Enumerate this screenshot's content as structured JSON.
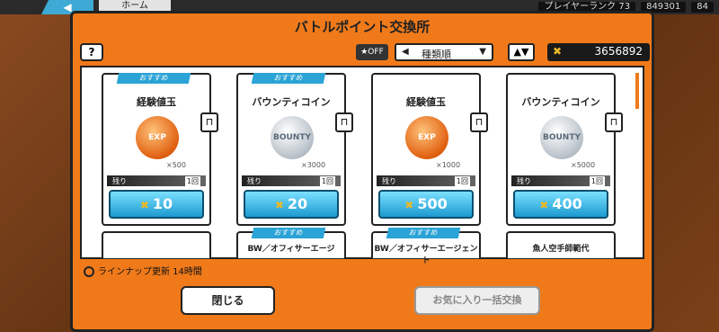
{
  "topbar": {
    "back_label": "◀",
    "home_label": "ホーム",
    "player_rank_label": "プレイヤーランク 73",
    "currency1": "849301",
    "currency2": "84"
  },
  "dialog": {
    "title": "バトルポイント交換所",
    "help_label": "?",
    "fav_toggle_label": "★OFF",
    "sort_label": "種類順",
    "order_label": "▲▼",
    "points_value": "3656892",
    "lineup_text": "ラインナップ更新 14時間",
    "close_label": "閉じる",
    "fav_exchange_label": "お気に入り一括交換"
  },
  "cards": [
    {
      "recommend": "おすすめ",
      "name": "経験値玉",
      "icon": "exp-orb",
      "qty": "×500",
      "remain_label": "残り",
      "remain_value": "1回",
      "price": "10"
    },
    {
      "recommend": "おすすめ",
      "name": "バウンティコイン",
      "icon": "bounty-coin",
      "qty": "×3000",
      "remain_label": "残り",
      "remain_value": "1回",
      "price": "20"
    },
    {
      "recommend": "",
      "name": "経験値玉",
      "icon": "exp-orb",
      "qty": "×1000",
      "remain_label": "残り",
      "remain_value": "1回",
      "price": "500"
    },
    {
      "recommend": "",
      "name": "バウンティコイン",
      "icon": "bounty-coin",
      "qty": "×5000",
      "remain_label": "残り",
      "remain_value": "1回",
      "price": "400"
    }
  ],
  "next_cards": [
    {
      "recommend": "",
      "name": ""
    },
    {
      "recommend": "おすすめ",
      "name": "BW／オフィサーエージ"
    },
    {
      "recommend": "おすすめ",
      "name": "BW／オフィサーエージェント"
    },
    {
      "recommend": "",
      "name": "魚人空手師範代"
    }
  ],
  "colors": {
    "orange": "#f07a1a",
    "blue": "#2aa3d6",
    "gold": "#e8b82a"
  }
}
